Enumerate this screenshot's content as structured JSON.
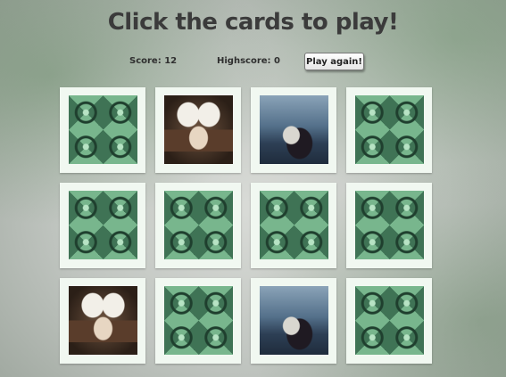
{
  "title": "Click the cards to play!",
  "score_label": "Score: 12",
  "highscore_label": "Highscore: 0",
  "play_again_label": "Play again!",
  "cards": [
    {
      "state": "face-down",
      "image": ""
    },
    {
      "state": "face-up",
      "image": "upside-down-figure-photo"
    },
    {
      "state": "face-up",
      "image": "woman-with-cello-photo"
    },
    {
      "state": "face-down",
      "image": ""
    },
    {
      "state": "face-down",
      "image": ""
    },
    {
      "state": "face-down",
      "image": ""
    },
    {
      "state": "face-down",
      "image": ""
    },
    {
      "state": "face-down",
      "image": ""
    },
    {
      "state": "face-up",
      "image": "upside-down-figure-photo"
    },
    {
      "state": "face-down",
      "image": ""
    },
    {
      "state": "face-up",
      "image": "woman-with-cello-photo"
    },
    {
      "state": "face-down",
      "image": ""
    }
  ],
  "colors": {
    "card_frame": "#f1f8f1",
    "card_back": "#6fa985",
    "title": "#3b3b3b"
  }
}
